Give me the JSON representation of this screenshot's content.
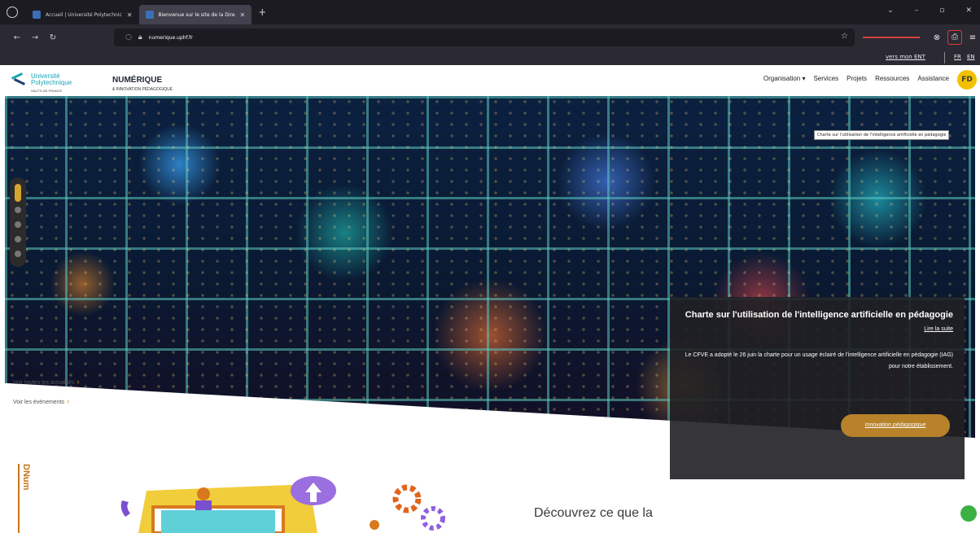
{
  "browser": {
    "tabs": [
      {
        "label": "Accueil | Université Polytechnic"
      },
      {
        "label": "Bienvenue sur le site de la Dire"
      }
    ],
    "url": "numerique.uphf.fr",
    "new_tab": "+"
  },
  "util_links": {
    "ent": "vers mon ENT",
    "fr": "FR",
    "en": "EN"
  },
  "site": {
    "university_line1": "Université",
    "university_line2": "Polytechnique",
    "university_sub": "HAUTS-DE-FRANCE",
    "brand_title": "NUMÉRIQUE",
    "brand_subtitle": "& INNOVATION PÉDAGOGIQUE",
    "menu": [
      "Organisation ▾",
      "Services",
      "Projets",
      "Ressources",
      "Assistance"
    ],
    "accessibility_glyph": "FD"
  },
  "hero": {
    "tooltip": "Charte sur l'utilisation de l'intelligence artificielle en pédagogie",
    "slides_count": 5,
    "active_slide": 1
  },
  "links": {
    "all_news": "Voir toutes les actualités",
    "events": "Voir les événements"
  },
  "news_card": {
    "title": "Charte sur l'utilisation de l'intelligence artificielle en pédagogie",
    "read_more": "Lire la suite",
    "body": "Le CFVE a adopté le 26 juin la charte pour un usage éclairé de l'intelligence artificielle en pédagogie (IAG) pour notre établissement.",
    "tag": "Innovation pédagogique"
  },
  "section": {
    "side_label": "DNum",
    "heading": "Découvrez ce que la"
  },
  "colors": {
    "accent_orange": "#c8761a",
    "teal": "#1aa6b7",
    "card_button": "#b7822a",
    "highlight_red": "#e23a3a"
  }
}
